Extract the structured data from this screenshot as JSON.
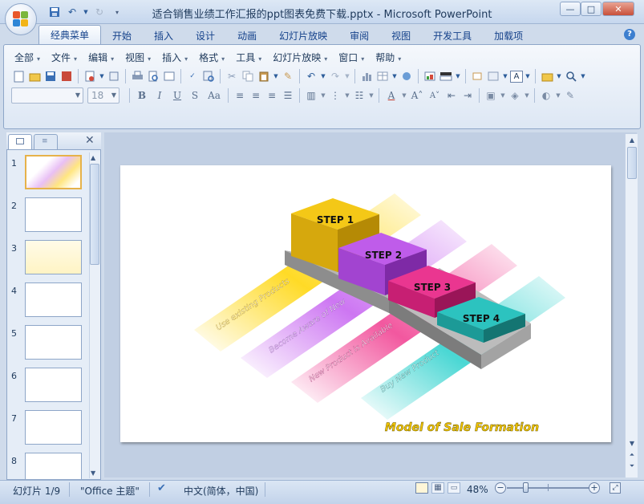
{
  "window": {
    "title": "适合销售业绩工作汇报的ppt图表免费下载.pptx - Microsoft PowerPoint",
    "minimize_label": "—",
    "maximize_label": "□",
    "close_label": "✕"
  },
  "ribbon": {
    "tabs": [
      {
        "label": "经典菜单",
        "active": true
      },
      {
        "label": "开始"
      },
      {
        "label": "插入"
      },
      {
        "label": "设计"
      },
      {
        "label": "动画"
      },
      {
        "label": "幻灯片放映"
      },
      {
        "label": "审阅"
      },
      {
        "label": "视图"
      },
      {
        "label": "开发工具"
      },
      {
        "label": "加载项"
      }
    ],
    "help_label": "?",
    "menus": [
      "全部",
      "文件",
      "编辑",
      "视图",
      "插入",
      "格式",
      "工具",
      "幻灯片放映",
      "窗口",
      "帮助"
    ],
    "font_name_value": "",
    "font_size_value": "18"
  },
  "panel": {
    "slides": [
      "1",
      "2",
      "3",
      "4",
      "5",
      "6",
      "7",
      "8"
    ],
    "close_label": "✕"
  },
  "slide": {
    "steps": [
      "STEP 1",
      "STEP 2",
      "STEP 3",
      "STEP 4"
    ],
    "ribbons": [
      "Use existing Products",
      "Become Aware of New",
      "New Product is Available",
      "Buy New Product"
    ],
    "caption": "Model of Sale Formation"
  },
  "status": {
    "slide_counter": "幻灯片 1/9",
    "theme": "\"Office 主题\"",
    "language": "中文(简体，中国)",
    "zoom": "48%"
  },
  "colors": {
    "step1": "#e0b800",
    "step2": "#b44fd8",
    "step3": "#dc2f86",
    "step4": "#25b3b0",
    "caption": "#f2c500"
  }
}
